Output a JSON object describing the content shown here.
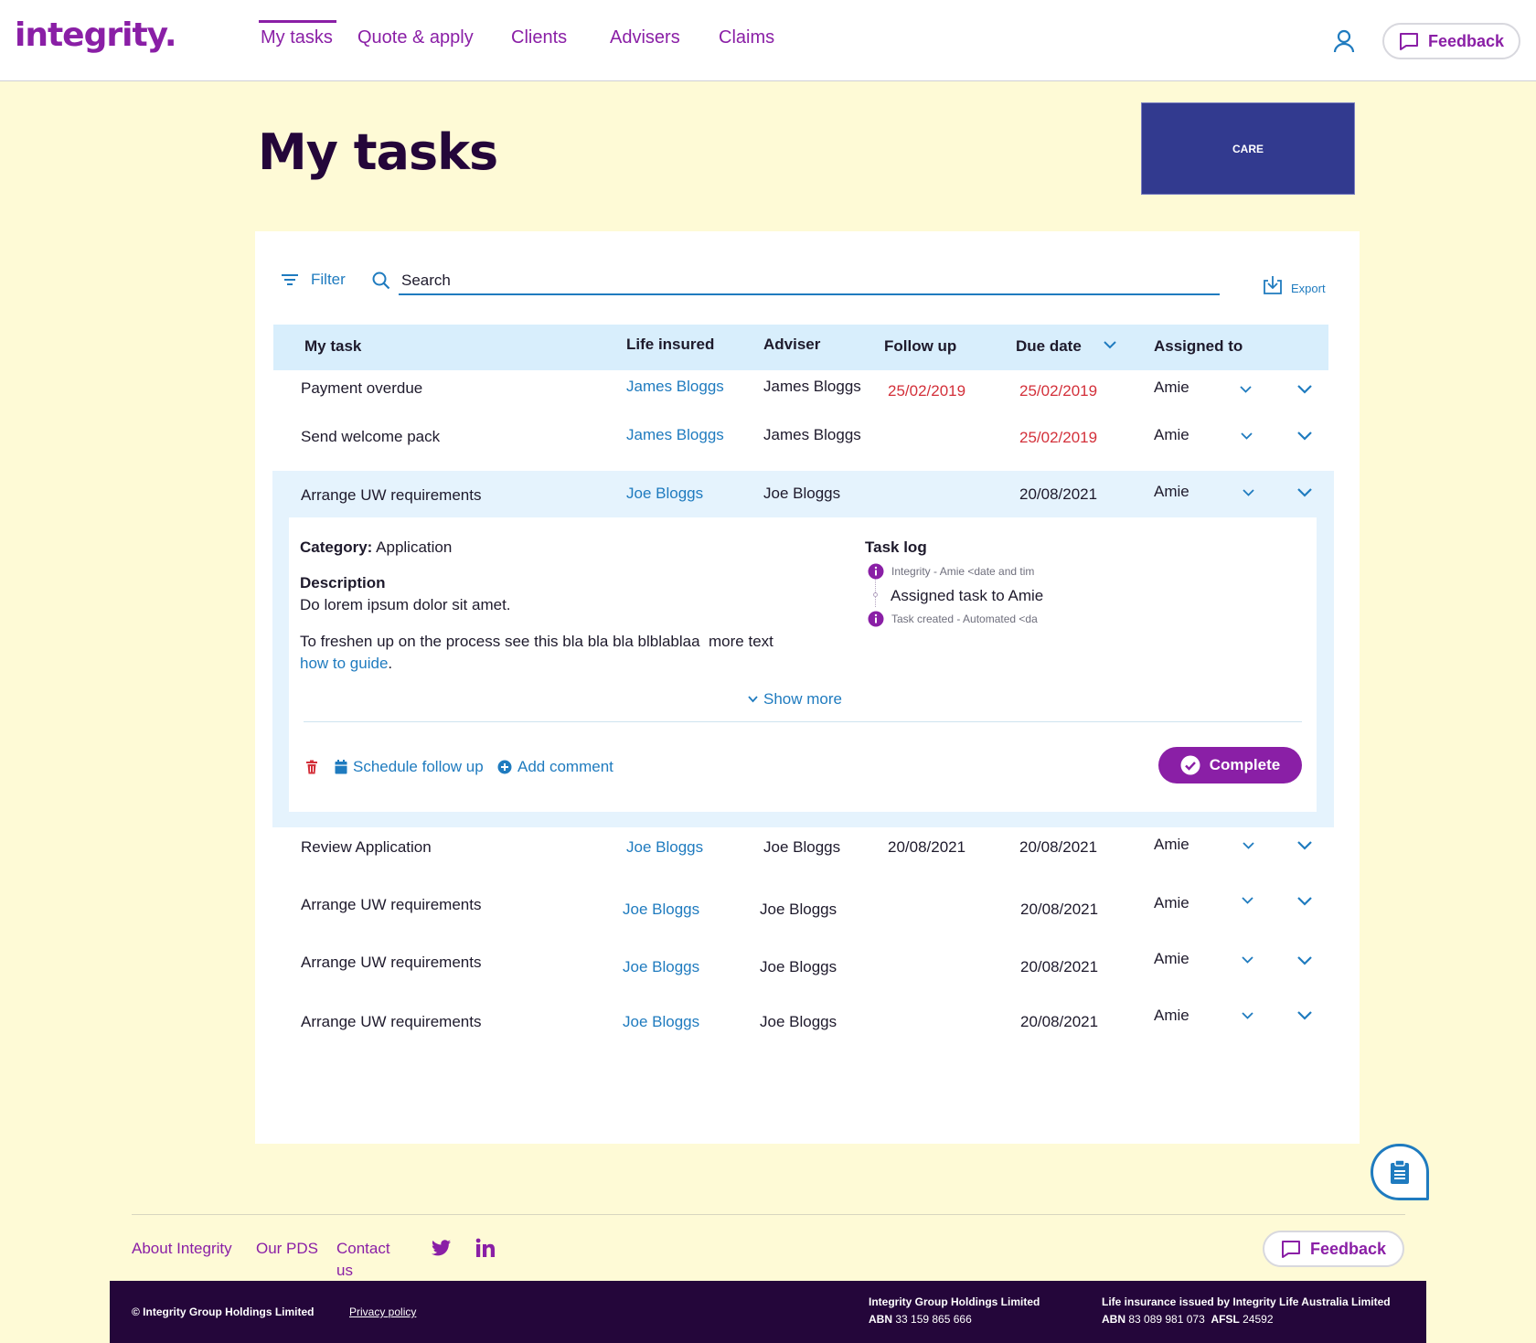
{
  "header": {
    "logo": "integrity.",
    "nav": [
      "My tasks",
      "Quote & apply",
      "Clients",
      "Advisers",
      "Claims"
    ],
    "feedback": "Feedback"
  },
  "page": {
    "title": "My tasks",
    "care_label": "CARE"
  },
  "toolbar": {
    "filter": "Filter",
    "search_value": "Search",
    "export": "Export"
  },
  "table": {
    "headers": [
      "My task",
      "Life insured",
      "Adviser",
      "Follow up",
      "Due date",
      "Assigned to"
    ],
    "rows": [
      {
        "task": "Payment overdue",
        "life_insured": "James Bloggs",
        "adviser": "James Bloggs",
        "follow_up": "25/02/2019",
        "due_date": "25/02/2019",
        "assigned": "Amie"
      },
      {
        "task": "Send welcome pack",
        "life_insured": "James Bloggs",
        "adviser": "James Bloggs",
        "follow_up": "",
        "due_date": "25/02/2019",
        "assigned": "Amie"
      },
      {
        "task": "Arrange UW requirements",
        "life_insured": "Joe Bloggs",
        "adviser": "Joe Bloggs",
        "follow_up": "",
        "due_date": "20/08/2021",
        "assigned": "Amie"
      },
      {
        "task": "Review Application",
        "life_insured": "Joe Bloggs",
        "adviser": "Joe Bloggs",
        "follow_up": "20/08/2021",
        "due_date": "20/08/2021",
        "assigned": "Amie"
      },
      {
        "task": "Arrange UW requirements",
        "life_insured": "Joe Bloggs",
        "adviser": "Joe Bloggs",
        "follow_up": "",
        "due_date": "20/08/2021",
        "assigned": "Amie"
      },
      {
        "task": "Arrange UW requirements",
        "life_insured": "Joe Bloggs",
        "adviser": "Joe Bloggs",
        "follow_up": "",
        "due_date": "20/08/2021",
        "assigned": "Amie"
      },
      {
        "task": "Arrange UW requirements",
        "life_insured": "Joe Bloggs",
        "adviser": "Joe Bloggs",
        "follow_up": "",
        "due_date": "20/08/2021",
        "assigned": "Amie"
      }
    ]
  },
  "detail": {
    "category_label": "Category:",
    "category_value": "Application",
    "description_label": "Description",
    "description": "Do lorem ipsum dolor sit amet.",
    "guide_text": "To freshen up on the process see this bla bla bla blblablaa  more text",
    "guide_link": "how to guide",
    "guide_end": ".",
    "show_more": "Show more",
    "task_log_title": "Task log",
    "log": [
      {
        "meta": "Integrity - Amie <date and tim"
      },
      {
        "text": "Assigned task to Amie"
      },
      {
        "meta": "Task created - Automated <da"
      }
    ],
    "schedule": "Schedule follow up",
    "add_comment": "Add comment",
    "complete": "Complete"
  },
  "footer": {
    "links": [
      "About Integrity",
      "Our PDS",
      "Contact",
      "us"
    ],
    "feedback": "Feedback",
    "copyright": "© Integrity Group Holdings Limited",
    "privacy": "Privacy policy",
    "company1": "Integrity Group Holdings Limited",
    "abn1_label": "ABN",
    "abn1": "33 159 865 666",
    "company2": "Life insurance issued by Integrity Life Australia Limited",
    "abn2_label": "ABN",
    "abn2": "83 089 981 073",
    "afsl_label": "AFSL",
    "afsl": "24592"
  },
  "colors": {
    "brand": "#8a1fa6",
    "link": "#1f7bbf",
    "overdue": "#d3303a",
    "background": "#fefad6",
    "footer": "#24063a"
  }
}
